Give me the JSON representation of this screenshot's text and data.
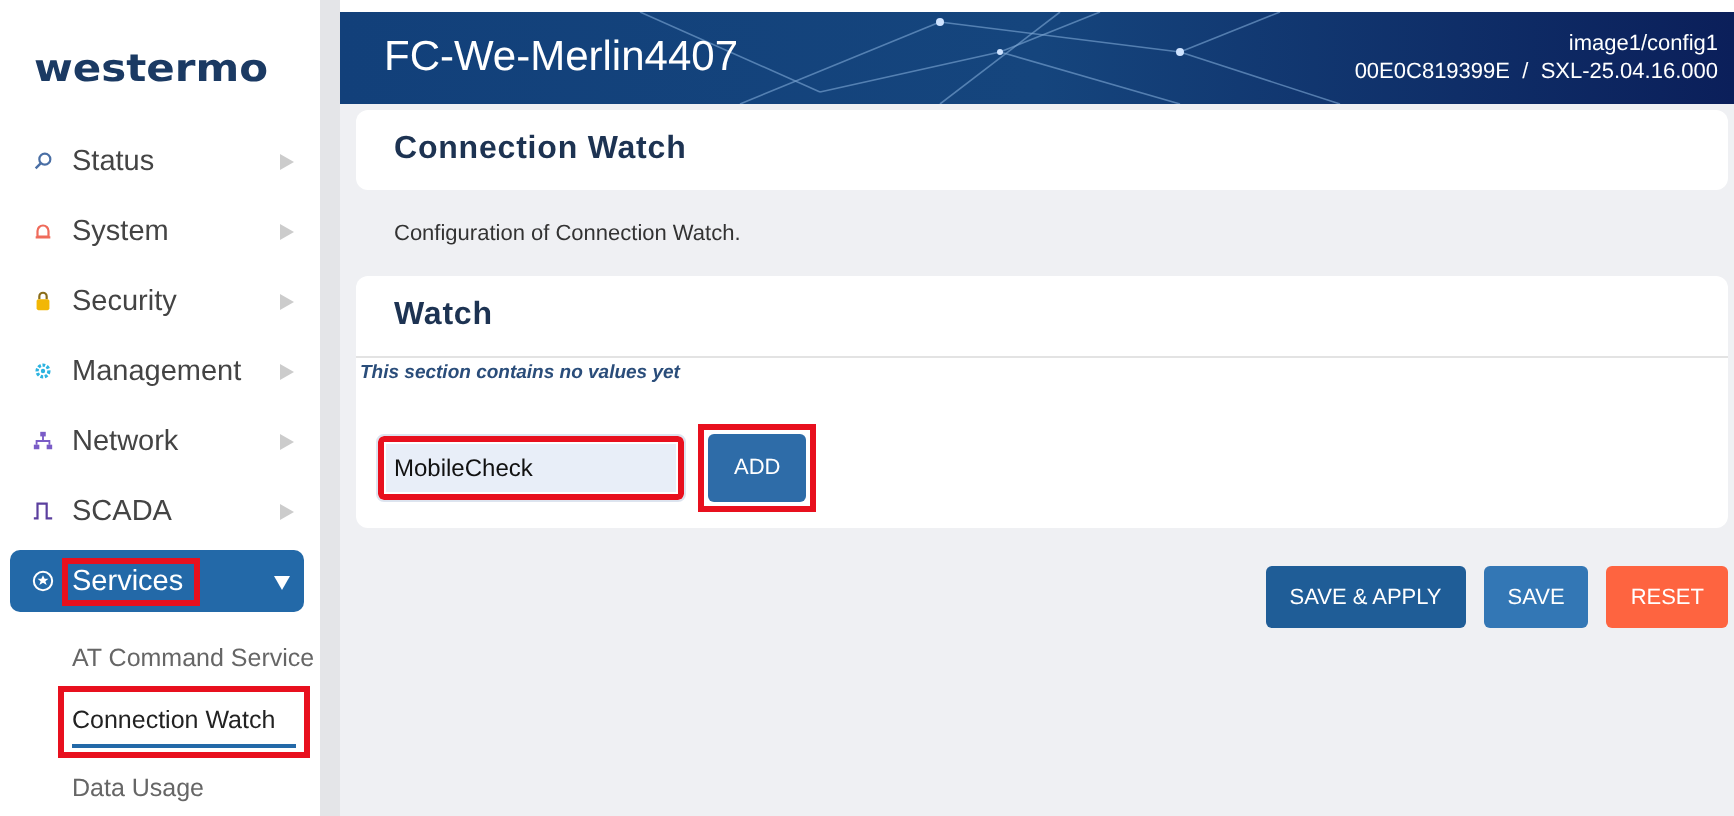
{
  "sidebar": {
    "logo": "westermo",
    "items": [
      {
        "label": "Status",
        "expanded": false,
        "selected": false,
        "highlighted": false
      },
      {
        "label": "System",
        "expanded": false,
        "selected": false,
        "highlighted": false
      },
      {
        "label": "Security",
        "expanded": false,
        "selected": false,
        "highlighted": false
      },
      {
        "label": "Management",
        "expanded": false,
        "selected": false,
        "highlighted": false
      },
      {
        "label": "Network",
        "expanded": false,
        "selected": false,
        "highlighted": false
      },
      {
        "label": "SCADA",
        "expanded": false,
        "selected": false,
        "highlighted": false
      },
      {
        "label": "Services",
        "expanded": true,
        "selected": true,
        "highlighted": true,
        "children": [
          {
            "label": "AT Command Service",
            "selected": false,
            "highlighted": false
          },
          {
            "label": "Connection Watch",
            "selected": true,
            "highlighted": true
          },
          {
            "label": "Data Usage",
            "selected": false,
            "highlighted": false
          }
        ]
      }
    ]
  },
  "header": {
    "hostname": "FC-We-Merlin4407",
    "image": "image1/config1",
    "serial": "00E0C819399E",
    "separator": "/",
    "version": "SXL-25.04.16.000"
  },
  "page": {
    "title": "Connection Watch",
    "description": "Configuration of Connection Watch.",
    "section": {
      "title": "Watch",
      "empty_note": "This section contains no values yet",
      "name_field": {
        "value": "MobileCheck",
        "highlighted": true
      },
      "add_button": {
        "label": "ADD",
        "highlighted": true
      }
    }
  },
  "buttons": [
    {
      "label": "SAVE & APPLY",
      "kind": "primary"
    },
    {
      "label": "SAVE",
      "kind": "secondary"
    },
    {
      "label": "RESET",
      "kind": "danger"
    }
  ]
}
